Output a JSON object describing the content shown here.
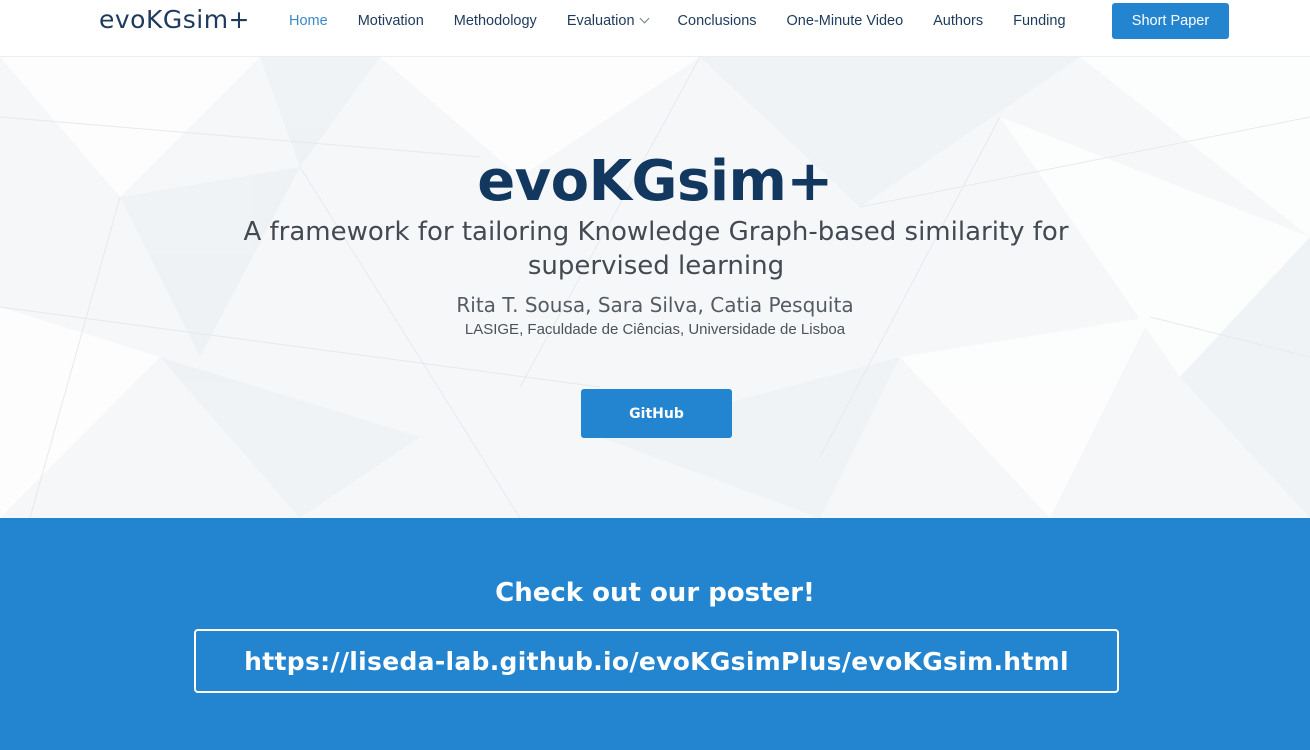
{
  "header": {
    "logo": "evoKGsim+",
    "nav": [
      {
        "label": "Home",
        "active": true
      },
      {
        "label": "Motivation"
      },
      {
        "label": "Methodology"
      },
      {
        "label": "Evaluation",
        "dropdown": true
      },
      {
        "label": "Conclusions"
      },
      {
        "label": "One-Minute Video"
      },
      {
        "label": "Authors"
      },
      {
        "label": "Funding"
      }
    ],
    "cta_label": "Short Paper"
  },
  "hero": {
    "title": "evoKGsim+",
    "subtitle": "A framework for tailoring Knowledge Graph-based similarity for supervised learning",
    "authors": "Rita T. Sousa, Sara Silva, Catia Pesquita",
    "affiliation": "LASIGE, Faculdade de Ciências, Universidade de Lisboa",
    "github_label": "GitHub"
  },
  "poster": {
    "title": "Check out our poster!",
    "url": "https://liseda-lab.github.io/evoKGsimPlus/evoKGsim.html"
  },
  "colors": {
    "accent": "#2384cf",
    "navy": "#13385f",
    "hero_bg": "#f5f7f9"
  }
}
